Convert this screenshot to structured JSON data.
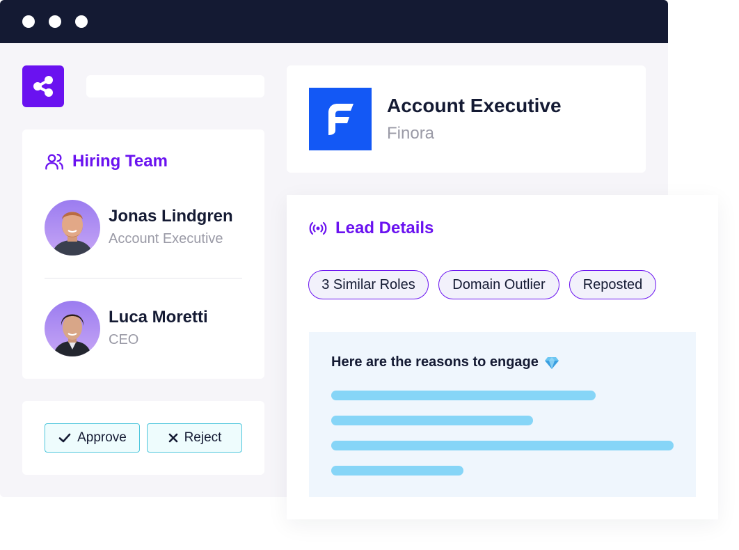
{
  "search": {
    "placeholder": ""
  },
  "hiring_team": {
    "title": "Hiring Team",
    "members": [
      {
        "name": "Jonas Lindgren",
        "role": "Account Executive"
      },
      {
        "name": "Luca Moretti",
        "role": "CEO"
      }
    ]
  },
  "actions": {
    "approve_label": "Approve",
    "reject_label": "Reject"
  },
  "job": {
    "title": "Account Executive",
    "company": "Finora"
  },
  "lead_details": {
    "title": "Lead Details",
    "tags": [
      "3 Similar Roles",
      "Domain Outlier",
      "Reposted"
    ],
    "reasons_title": "Here are the reasons to engage"
  },
  "colors": {
    "titlebar": "#141a33",
    "accent": "#6a12f0",
    "company_logo": "#1358f5",
    "button_border": "#4cc6dc",
    "placeholder_bar": "#86d5f7"
  },
  "icons": [
    "window-dot",
    "share-icon",
    "users-icon",
    "check-icon",
    "close-icon",
    "broadcast-icon",
    "diamond-icon"
  ]
}
